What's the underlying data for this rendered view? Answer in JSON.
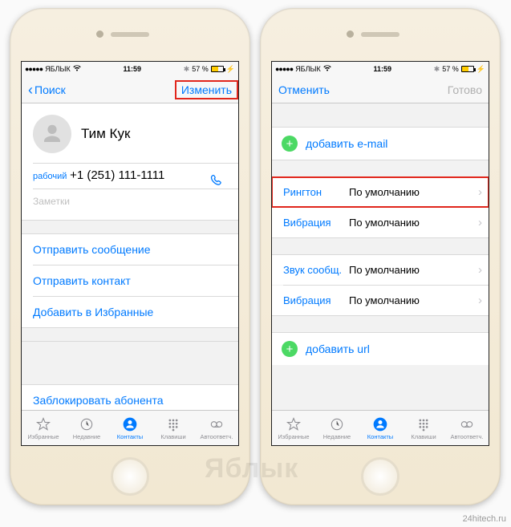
{
  "statusbar": {
    "carrier": "ЯБЛЫК",
    "time": "11:59",
    "battery_pct": "57 %"
  },
  "left": {
    "nav_back": "Поиск",
    "nav_right": "Изменить",
    "contact_name": "Тим Кук",
    "phone_label": "рабочий",
    "phone_number": "+1 (251) 111-1111",
    "notes_placeholder": "Заметки",
    "actions": {
      "send_message": "Отправить сообщение",
      "send_contact": "Отправить контакт",
      "add_favorite": "Добавить в Избранные",
      "block": "Заблокировать абонента"
    }
  },
  "right": {
    "nav_cancel": "Отменить",
    "nav_done": "Готово",
    "add_email": "добавить e-mail",
    "rows": {
      "ringtone_k": "Рингтон",
      "ringtone_v": "По умолчанию",
      "vibration_k": "Вибрация",
      "vibration_v": "По умолчанию",
      "msg_sound_k": "Звук сообщ.",
      "msg_sound_v": "По умолчанию",
      "msg_vibration_k": "Вибрация",
      "msg_vibration_v": "По умолчанию"
    },
    "add_url": "добавить url"
  },
  "tabs": {
    "favorites": "Избранные",
    "recents": "Недавние",
    "contacts": "Контакты",
    "keypad": "Клавиши",
    "voicemail": "Автоответч."
  },
  "watermark": "Яблык",
  "credit": "24hitech.ru"
}
